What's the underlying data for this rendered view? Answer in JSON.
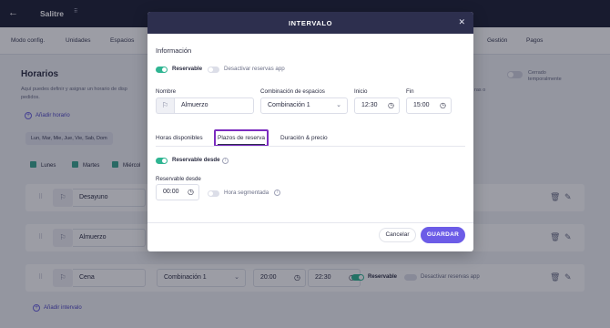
{
  "topbar": {
    "back_icon": "arrow-left-icon",
    "app_title": "Salitre",
    "menu_glyph": "⠿"
  },
  "tabs": [
    "Modo config.",
    "Unidades",
    "Espacios",
    "Gestión",
    "Pagos"
  ],
  "background": {
    "title": "Horarios",
    "desc_line1": "Aquí puedes definir y asignar un horario de disp",
    "desc_line2": "pedidos.",
    "desc_right": "ras o",
    "cerrado_label_1": "Cerrado",
    "cerrado_label_2": "temporalmente",
    "add_top": "Añadir horario",
    "days_chip": "Lun, Mar, Mie, Jue, Vie, Sab, Dom",
    "day_checks": [
      "Lunes",
      "Martes",
      "Miércol"
    ],
    "rows": [
      {
        "name": "Desayuno"
      },
      {
        "name": "Almuerzo"
      },
      {
        "name": "Cena",
        "combination": "Combinación 1",
        "start": "20:00",
        "end": "22:30",
        "reservable": "Reservable",
        "deactivate": "Desactivar reservas app"
      }
    ],
    "add_bottom": "Añadir intervalo"
  },
  "modal": {
    "title": "INTERVALO",
    "section_title": "Información",
    "reservable_label": "Reservable",
    "deactivate_label": "Desactivar reservas app",
    "name_label": "Nombre",
    "name_value": "Almuerzo",
    "combination_label": "Combinación de espacios",
    "combination_value": "Combinación 1",
    "start_label": "Inicio",
    "start_value": "12:30",
    "end_label": "Fin",
    "end_value": "15:00",
    "tab_hours": "Horas disponibles",
    "tab_terms": "Plazos de reserva",
    "tab_duration": "Duración & precio",
    "reservable_from_toggle": "Reservable desde",
    "reservable_from_label": "Reservable desde",
    "reservable_from_value": "00:00",
    "segmented_label": "Hora segmentada",
    "cancel": "Cancelar",
    "save": "GUARDAR"
  },
  "colors": {
    "header": "#2d2f4e",
    "toggle_on": "#2fb592",
    "primary": "#6c5ce7",
    "active_tab_border": "#7b2cbf"
  }
}
